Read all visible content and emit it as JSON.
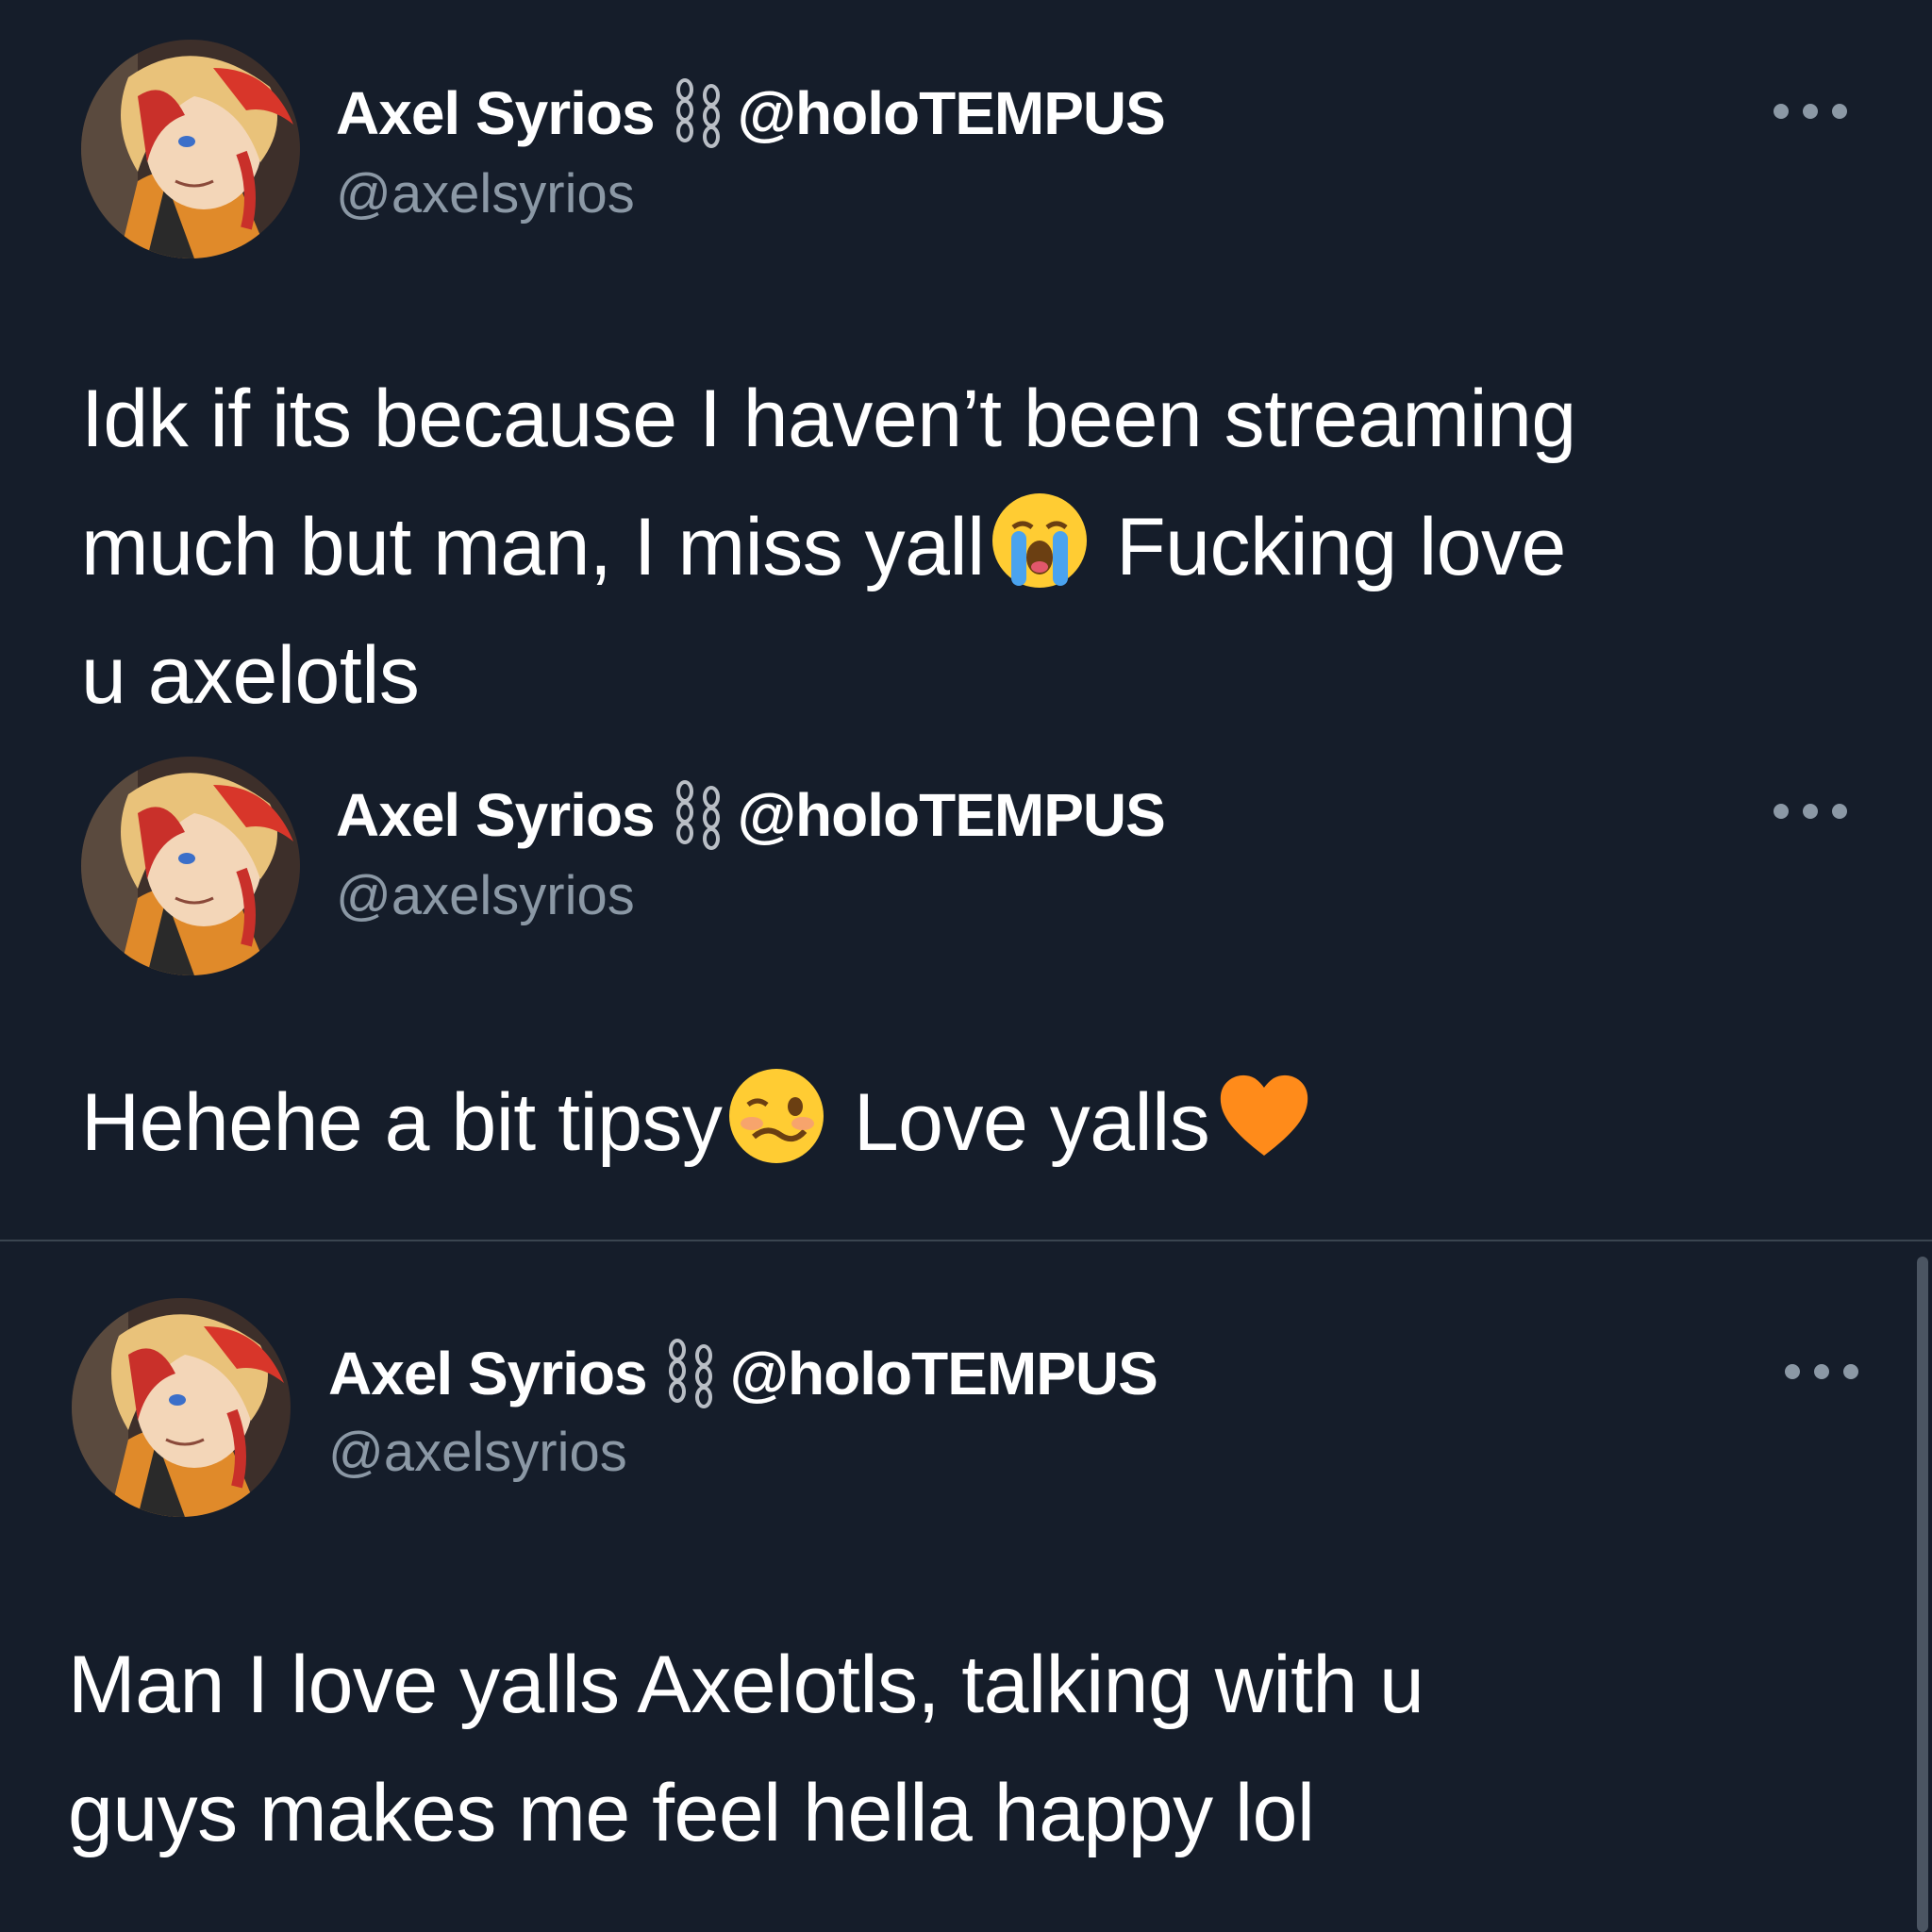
{
  "tweets": [
    {
      "display_name": "Axel Syrios",
      "affiliation": "@holoTEMPUS",
      "handle": "@axelsyrios",
      "text_lines": [
        "Idk if its because I haven’t been streaming",
        "much but man, I miss yall",
        "Fucking love",
        "u axelotls"
      ],
      "emojis": [
        "loudly-crying-face"
      ]
    },
    {
      "display_name": "Axel Syrios",
      "affiliation": "@holoTEMPUS",
      "handle": "@axelsyrios",
      "text_parts": [
        "Hehehe a bit tipsy",
        "Love yalls"
      ],
      "emojis": [
        "woozy-face",
        "orange-heart"
      ]
    },
    {
      "display_name": "Axel Syrios",
      "affiliation": "@holoTEMPUS",
      "handle": "@axelsyrios",
      "text_lines": [
        "Man I love yalls Axelotls, talking with u",
        "guys makes me feel hella happy lol"
      ]
    }
  ],
  "colors": {
    "background": "#151d2a",
    "text": "#ffffff",
    "secondary": "#8b98a5",
    "divider": "#3a4550"
  },
  "icons": {
    "affiliation": "chain-link-icon",
    "more": "more-options-icon"
  }
}
